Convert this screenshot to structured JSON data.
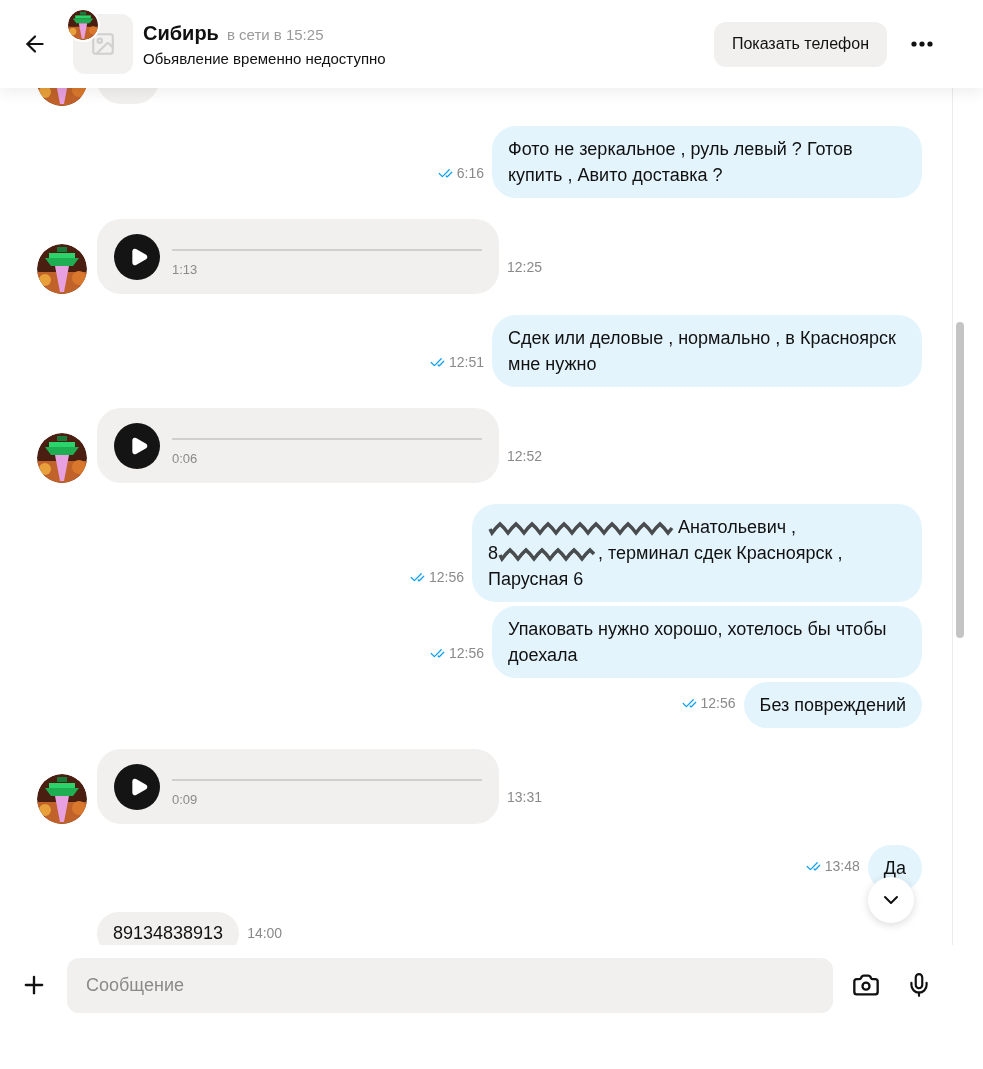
{
  "header": {
    "title": "Сибирь",
    "status": "в сети в 15:25",
    "subtitle": "Обьявление временно недоступно",
    "phone_button": "Показать телефон"
  },
  "messages": [
    {
      "kind": "text",
      "outgoing": true,
      "read": true,
      "time": "6:16",
      "text": "Фото не зеркальное , руль левый ? Готов купить , Авито доставка ?"
    },
    {
      "kind": "voice",
      "outgoing": false,
      "time": "12:25",
      "duration": "1:13"
    },
    {
      "kind": "text",
      "outgoing": true,
      "read": true,
      "time": "12:51",
      "text": "Сдек или деловые , нормально , в Красноярск мне нужно"
    },
    {
      "kind": "voice",
      "outgoing": false,
      "time": "12:52",
      "duration": "0:06"
    },
    {
      "kind": "redacted",
      "outgoing": true,
      "read": true,
      "time": "12:56",
      "lines": [
        [
          {
            "kind": "hidden"
          },
          {
            "kind": "text",
            "text": "Анатольевич ,"
          }
        ],
        [
          {
            "kind": "text",
            "text": "8"
          },
          {
            "kind": "hidden"
          },
          {
            "kind": "text",
            "text": ", терминал сдек Красноярск ,"
          }
        ],
        [
          {
            "kind": "text",
            "text": "Парусная 6"
          }
        ]
      ]
    },
    {
      "kind": "text",
      "outgoing": true,
      "read": true,
      "time": "12:56",
      "text": "Упаковать нужно хорошо, хотелось бы чтобы доехала"
    },
    {
      "kind": "text",
      "outgoing": true,
      "read": true,
      "time": "12:56",
      "text": "Без повреждений"
    },
    {
      "kind": "voice",
      "outgoing": false,
      "time": "13:31",
      "duration": "0:09"
    },
    {
      "kind": "text",
      "outgoing": true,
      "read": true,
      "time": "13:48",
      "text": "Да"
    },
    {
      "kind": "plain",
      "outgoing": false,
      "time": "14:00",
      "text": "89134838913"
    }
  ],
  "composer": {
    "placeholder": "Сообщение"
  }
}
